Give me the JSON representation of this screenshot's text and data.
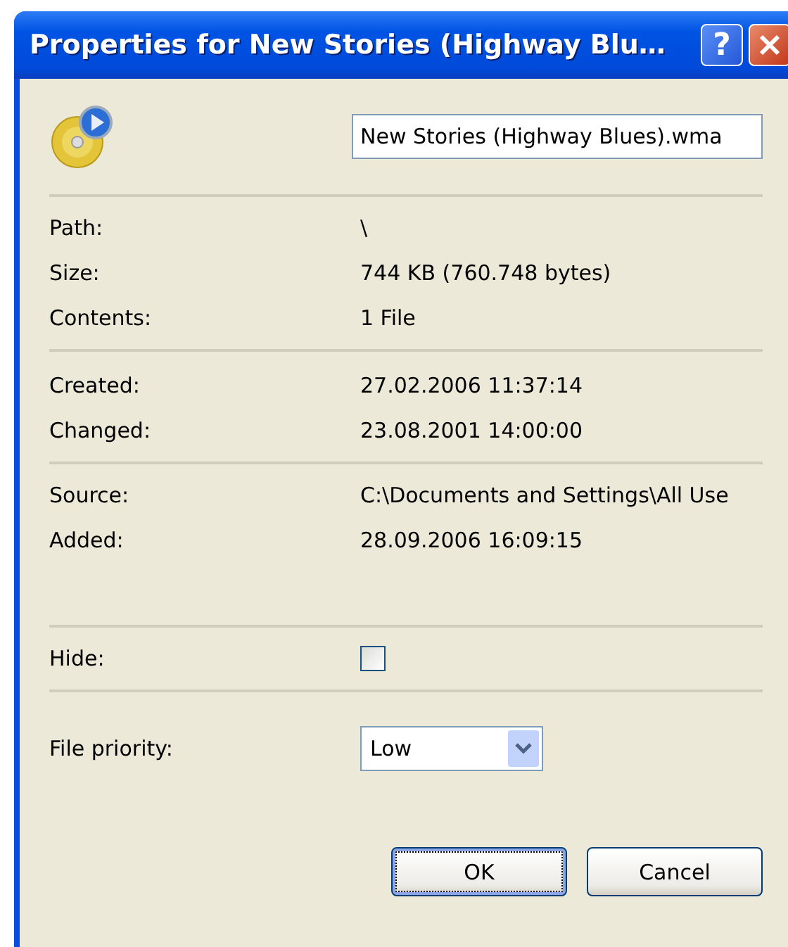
{
  "window": {
    "title": "Properties for New Stories (Highway Blu…"
  },
  "title_buttons": [
    {
      "kind": "help",
      "label": "?"
    },
    {
      "kind": "close"
    }
  ],
  "name_field": {
    "value": "New Stories (Highway Blues).wma"
  },
  "sections": [
    [
      {
        "kind": "text",
        "label": "Path:",
        "value": "\\"
      },
      {
        "kind": "text",
        "label": "Size:",
        "value": "744 KB (760.748 bytes)"
      },
      {
        "kind": "text",
        "label": "Contents:",
        "value": "1 File"
      }
    ],
    [
      {
        "kind": "text",
        "label": "Created:",
        "value": "27.02.2006 11:37:14"
      },
      {
        "kind": "text",
        "label": "Changed:",
        "value": "23.08.2001 14:00:00"
      }
    ],
    [
      {
        "kind": "text",
        "label": "Source:",
        "value": "C:\\Documents and Settings\\All Use"
      },
      {
        "kind": "text",
        "label": "Added:",
        "value": "28.09.2006 16:09:15"
      }
    ],
    [
      {
        "kind": "checkbox",
        "label": "Hide:",
        "checked": false
      }
    ],
    [
      {
        "kind": "select",
        "label": "File priority:",
        "value": "Low"
      }
    ]
  ],
  "buttons": [
    {
      "label": "OK",
      "default": true
    },
    {
      "label": "Cancel",
      "default": false
    }
  ]
}
